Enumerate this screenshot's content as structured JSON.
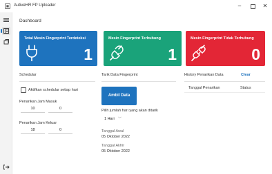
{
  "window": {
    "title": "AutiveHR FP Uploader",
    "controls": [
      "minimize-icon",
      "maximize-icon",
      "close-icon"
    ]
  },
  "sidebar": {
    "items": [
      {
        "icon": "hamburger-menu-icon"
      },
      {
        "icon": "dashboard-icon",
        "active": true
      },
      {
        "icon": "sync-icon"
      },
      {
        "icon": "logout-icon"
      }
    ]
  },
  "page": {
    "title": "Dashboard"
  },
  "cards": [
    {
      "title": "Total Mesin Fingerprint Terdeteksi",
      "value": "1",
      "color": "#1e73be",
      "icon": "plug-icon"
    },
    {
      "title": "Mesin Fingerprint Terhubung",
      "value": "1",
      "color": "#1aa37a",
      "icon": "plug-connected-icon"
    },
    {
      "title": "Mesin Fingerprint Tidak Terhubung",
      "value": "0",
      "color": "#e32636",
      "icon": "plug-disconnected-icon"
    }
  ],
  "schedular": {
    "title": "Schedular",
    "checkbox_label": "Aktifkan schedular setiap hari",
    "checked": false,
    "masuk_label": "Penarikan Jam Masuk",
    "masuk_hour": "10",
    "masuk_minute": "0",
    "keluar_label": "Penarikan Jam Keluar",
    "keluar_hour": "18",
    "keluar_minute": "0"
  },
  "tarik": {
    "title": "Tarik Data Fingerprint",
    "button_label": "Ambil Data",
    "days_label": "Pilih jumlah hari yang akan ditarik",
    "days_value": "1 Hari",
    "start_label": "Tanggal Awal",
    "start_value": "05 Oktober 2022",
    "end_label": "Tanggal Akhir",
    "end_value": "05 Oktober 2022"
  },
  "history": {
    "title": "History Penarikan Data",
    "clear_label": "Clear",
    "columns": [
      "Tanggal Penarikan",
      "Status"
    ]
  }
}
